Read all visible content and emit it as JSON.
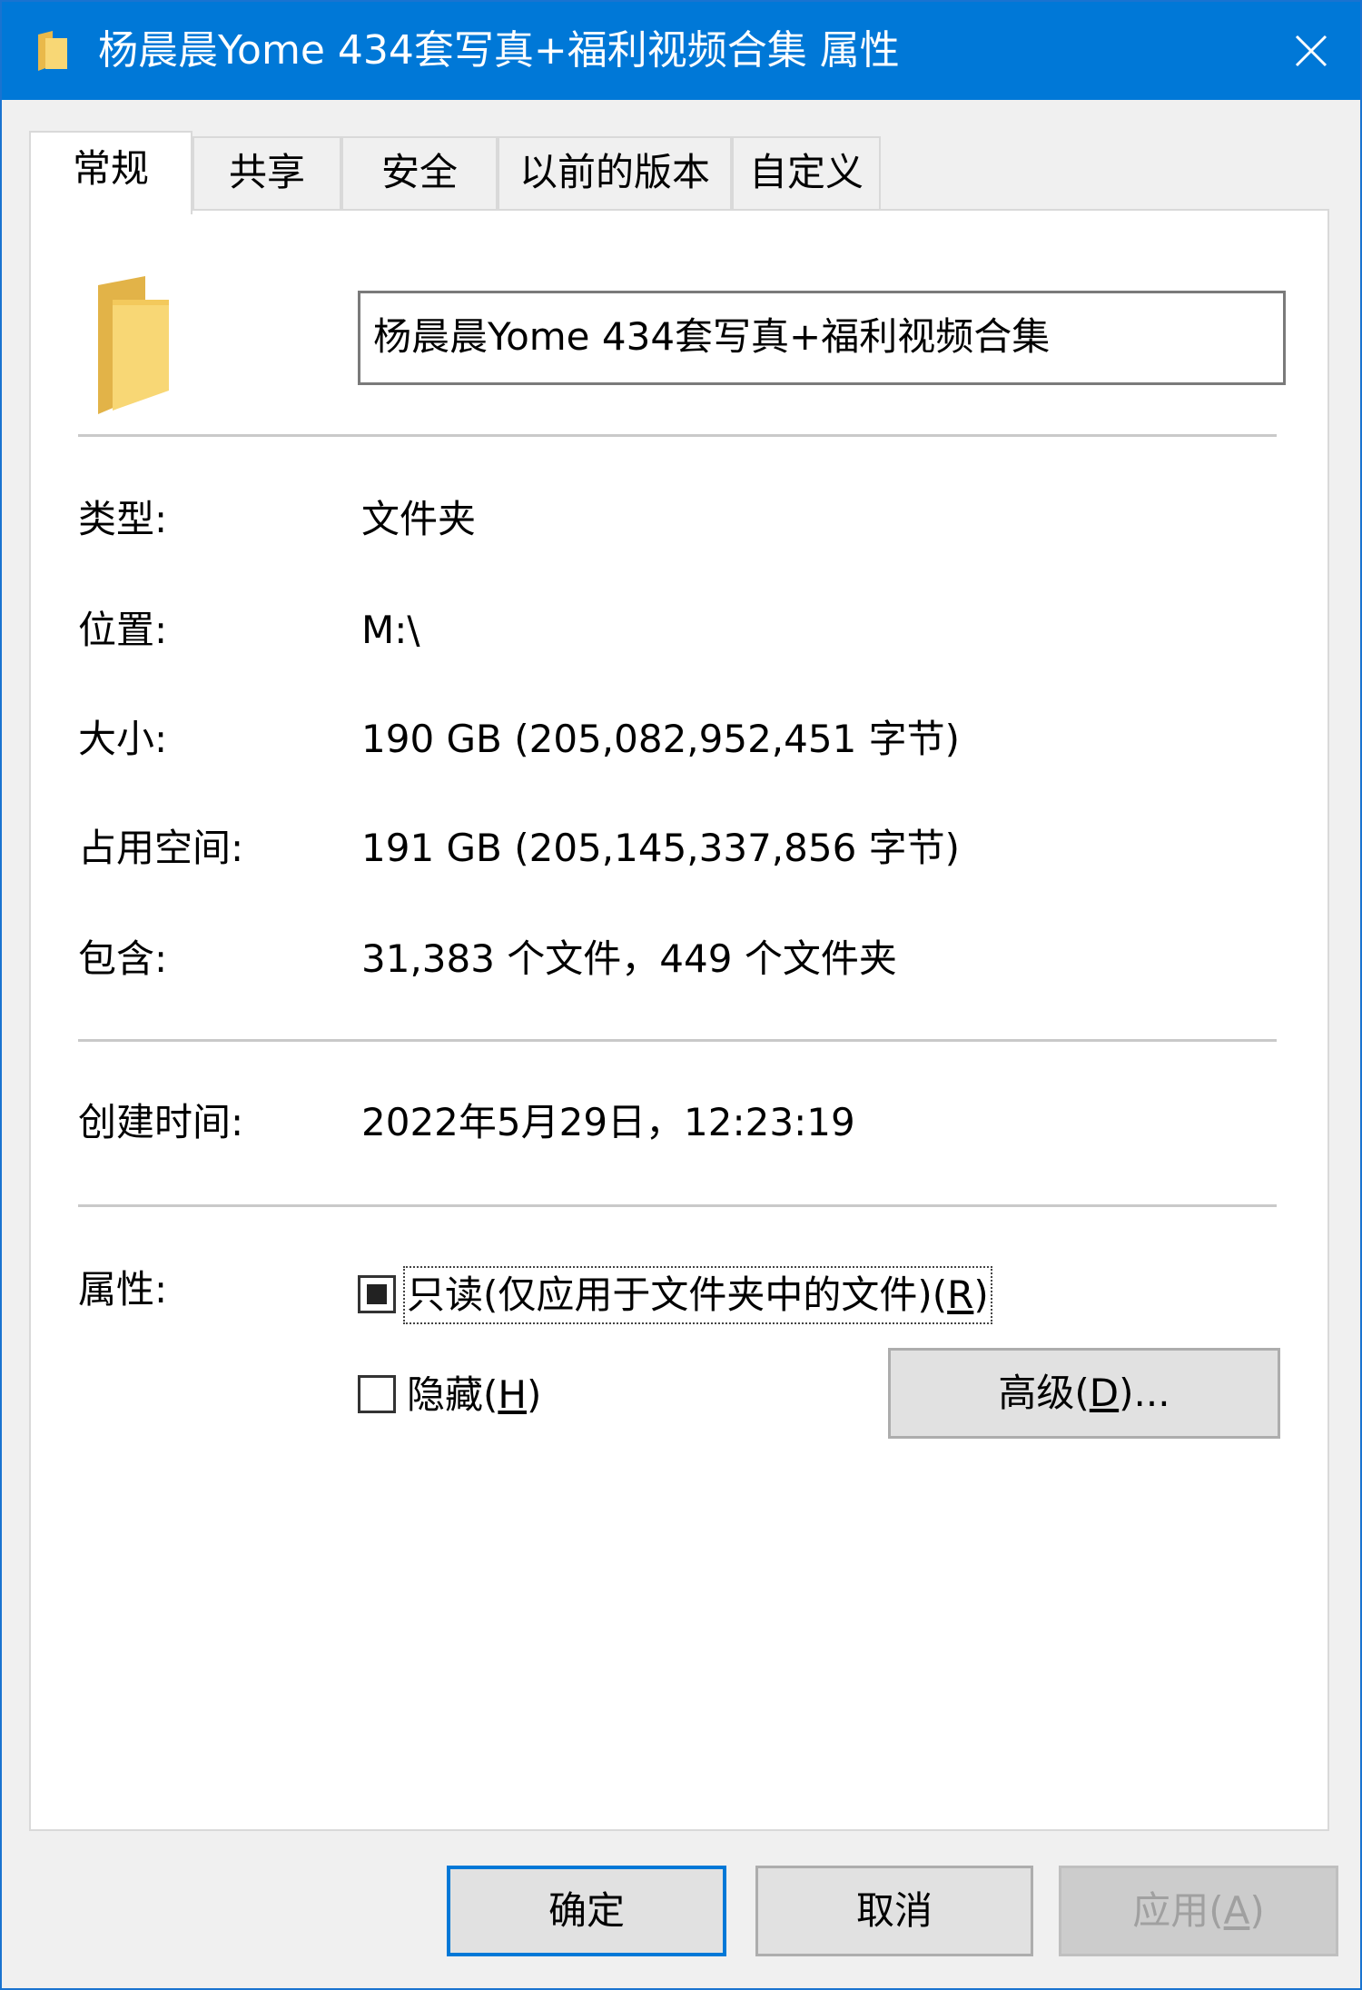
{
  "window": {
    "title": "杨晨晨Yome 434套写真+福利视频合集 属性",
    "close_glyph": "✕"
  },
  "tabs": [
    {
      "label": "常规",
      "active": true
    },
    {
      "label": "共享",
      "active": false
    },
    {
      "label": "安全",
      "active": false
    },
    {
      "label": "以前的版本",
      "active": false
    },
    {
      "label": "自定义",
      "active": false
    }
  ],
  "general": {
    "name": "杨晨晨Yome 434套写真+福利视频合集",
    "type": {
      "label": "类型:",
      "value": "文件夹"
    },
    "location": {
      "label": "位置:",
      "value": "M:\\"
    },
    "size": {
      "label": "大小:",
      "value": "190 GB (205,082,952,451 字节)"
    },
    "size_on_disk": {
      "label": "占用空间:",
      "value": "191 GB (205,145,337,856 字节)"
    },
    "contains": {
      "label": "包含:",
      "value": "31,383 个文件，449 个文件夹"
    },
    "created": {
      "label": "创建时间:",
      "value": "2022年5月29日，12:23:19"
    },
    "attributes": {
      "label": "属性:",
      "readonly": {
        "label_main": "只读(仅应用于文件夹中的文件)(",
        "accel": "R",
        "label_end": ")",
        "state": "indeterminate"
      },
      "hidden": {
        "label_main": "隐藏(",
        "accel": "H",
        "label_end": ")",
        "checked": false
      },
      "advanced": {
        "label_main": "高级(",
        "accel": "D",
        "label_end": ")..."
      }
    }
  },
  "buttons": {
    "ok": "确定",
    "cancel": "取消",
    "apply": {
      "label_main": "应用(",
      "accel": "A",
      "label_end": ")"
    }
  },
  "icons": {
    "title": "folder-icon",
    "big": "folder-icon",
    "close": "close-icon"
  },
  "colors": {
    "titlebar": "#0078d7",
    "folder": "#f8d775",
    "default_button_border": "#0078d7"
  }
}
